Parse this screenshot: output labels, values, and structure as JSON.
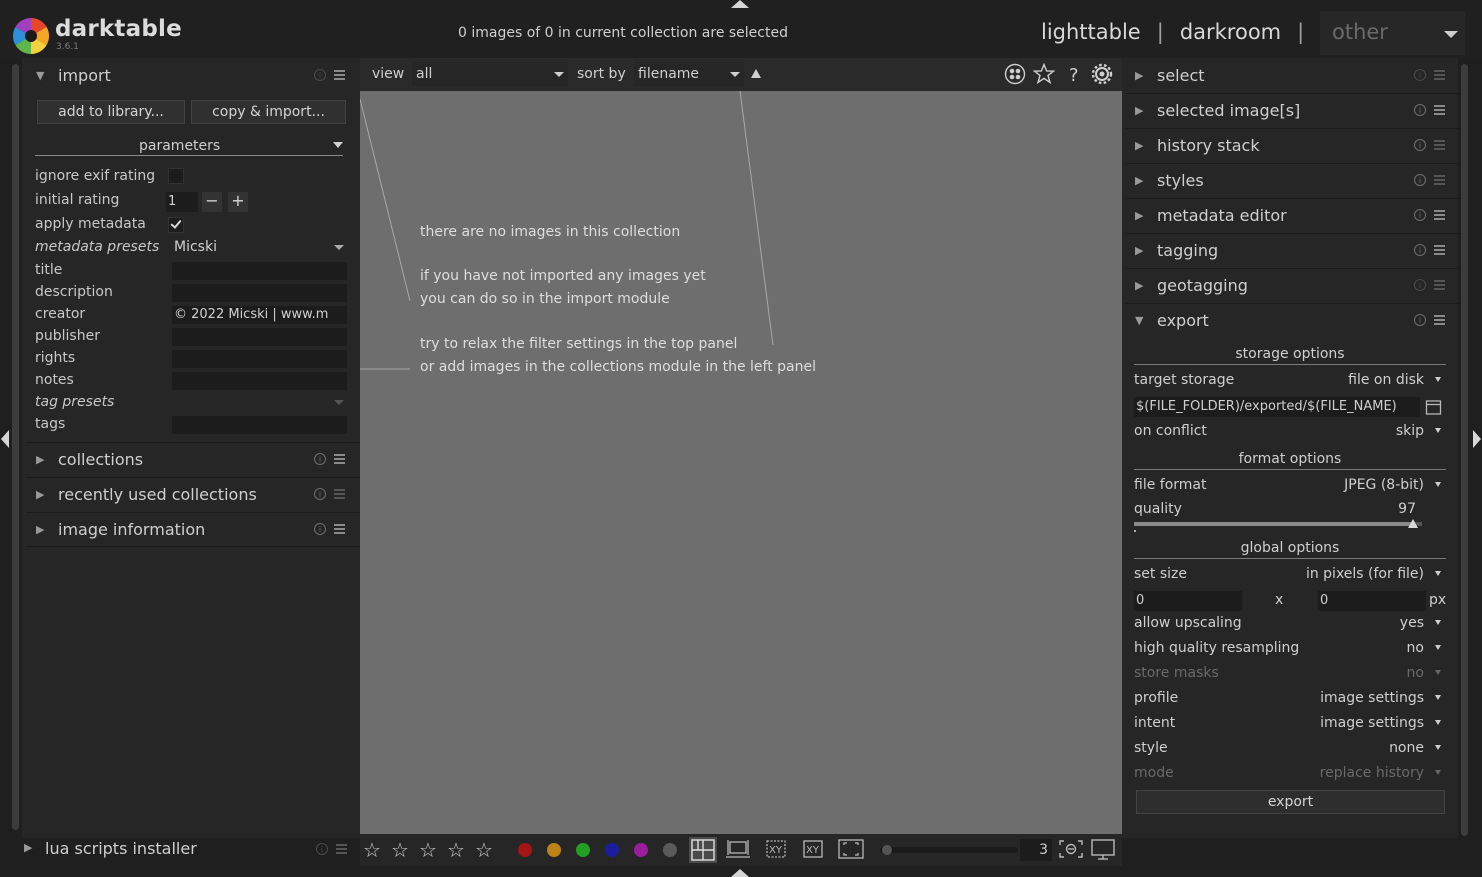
{
  "app": {
    "name": "darktable",
    "version": "3.6.1"
  },
  "header": {
    "selection_status": "0 images of 0 in current collection are selected",
    "views": [
      "lighttable",
      "darkroom"
    ],
    "separator": "|",
    "other_label": "other"
  },
  "left_panel": {
    "import": {
      "title": "import",
      "add_button": "add to library...",
      "copy_button": "copy & import...",
      "parameters_label": "parameters",
      "ignore_exif_label": "ignore exif rating",
      "ignore_exif_checked": false,
      "initial_rating_label": "initial rating",
      "initial_rating_value": "1",
      "apply_metadata_label": "apply metadata",
      "apply_metadata_checked": true,
      "metadata_presets_label": "metadata presets",
      "metadata_presets_value": "Micski",
      "title_label": "title",
      "description_label": "description",
      "creator_label": "creator",
      "creator_value": "© 2022 Micski | www.m",
      "publisher_label": "publisher",
      "rights_label": "rights",
      "notes_label": "notes",
      "tag_presets_label": "tag presets",
      "tags_label": "tags"
    },
    "modules": [
      "collections",
      "recently used collections",
      "image information"
    ],
    "bottom_module": "lua scripts installer"
  },
  "center": {
    "toolbar": {
      "view_label": "view",
      "view_value": "all",
      "sort_label": "sort by",
      "sort_value": "filename"
    },
    "help_lines": [
      "there are no images in this collection",
      "if you have not imported any images yet",
      "you can do so in the import module",
      "try to relax the filter settings in the top panel",
      "or add images in the collections module in the left panel"
    ],
    "zoom_value": "3",
    "color_labels": [
      "#a21616",
      "#bd8318",
      "#22a023",
      "#1a1e9c",
      "#9a1e9c",
      "#5a5a5a"
    ]
  },
  "right_panel": {
    "modules": [
      "select",
      "selected image[s]",
      "history stack",
      "styles",
      "metadata editor",
      "tagging",
      "geotagging"
    ],
    "export": {
      "title": "export",
      "storage_options": "storage options",
      "target_storage_label": "target storage",
      "target_storage_value": "file on disk",
      "path_value": "$(FILE_FOLDER)/exported/$(FILE_NAME)",
      "on_conflict_label": "on conflict",
      "on_conflict_value": "skip",
      "format_options": "format options",
      "file_format_label": "file format",
      "file_format_value": "JPEG (8-bit)",
      "quality_label": "quality",
      "quality_value": "97",
      "quality_fraction": 0.97,
      "global_options": "global options",
      "set_size_label": "set size",
      "set_size_value": "in pixels (for file)",
      "width_value": "0",
      "x_label": "x",
      "height_value": "0",
      "px_label": "px",
      "allow_upscaling_label": "allow upscaling",
      "allow_upscaling_value": "yes",
      "hq_resampling_label": "high quality resampling",
      "hq_resampling_value": "no",
      "store_masks_label": "store masks",
      "store_masks_value": "no",
      "profile_label": "profile",
      "profile_value": "image settings",
      "intent_label": "intent",
      "intent_value": "image settings",
      "style_label": "style",
      "style_value": "none",
      "mode_label": "mode",
      "mode_value": "replace history",
      "export_button": "export"
    }
  }
}
